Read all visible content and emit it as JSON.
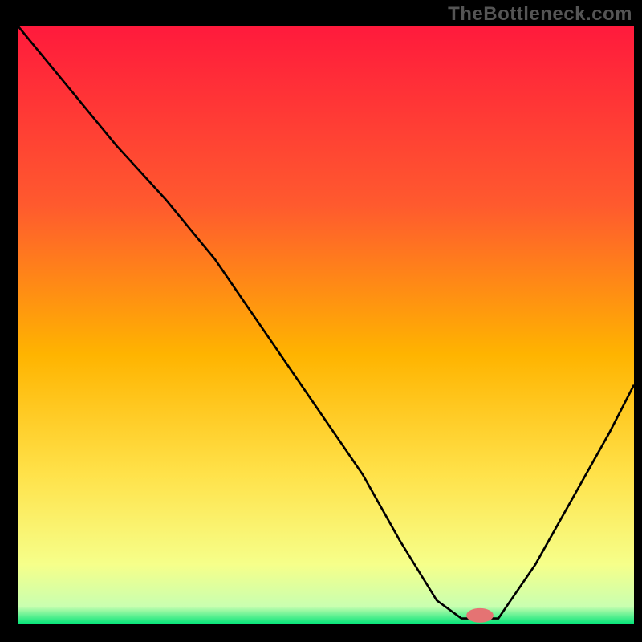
{
  "watermark": "TheBottleneck.com",
  "chart_data": {
    "type": "line",
    "title": "",
    "xlabel": "",
    "ylabel": "",
    "xlim": [
      0,
      100
    ],
    "ylim": [
      0,
      100
    ],
    "background_gradient": {
      "stops": [
        {
          "pos": 0.0,
          "color": "#ff1a3c"
        },
        {
          "pos": 0.3,
          "color": "#ff5a2e"
        },
        {
          "pos": 0.55,
          "color": "#ffb400"
        },
        {
          "pos": 0.75,
          "color": "#ffe24a"
        },
        {
          "pos": 0.9,
          "color": "#f6ff8a"
        },
        {
          "pos": 0.97,
          "color": "#c9ffb0"
        },
        {
          "pos": 1.0,
          "color": "#00e477"
        }
      ]
    },
    "series": [
      {
        "name": "bottleneck-curve",
        "color": "#000000",
        "x": [
          0,
          8,
          16,
          24,
          32,
          40,
          48,
          56,
          62,
          68,
          72,
          78,
          84,
          90,
          96,
          100
        ],
        "y": [
          100,
          90,
          80,
          71,
          61,
          49,
          37,
          25,
          14,
          4,
          1,
          1,
          10,
          21,
          32,
          40
        ]
      }
    ],
    "marker": {
      "name": "optimal-point",
      "x": 75,
      "y": 1.5,
      "color": "#e57373",
      "rx": 2.2,
      "ry": 1.2
    }
  }
}
